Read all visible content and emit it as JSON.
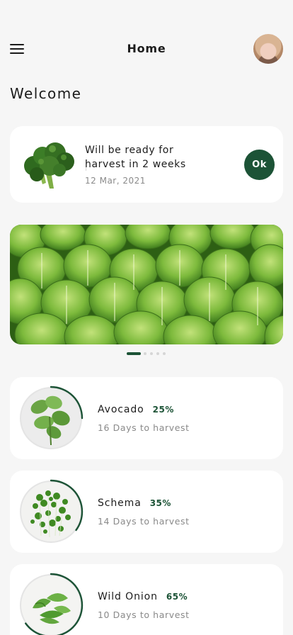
{
  "header": {
    "title": "Home"
  },
  "greeting": "Welcome",
  "notice": {
    "message": "Will be ready for harvest in 2 weeks",
    "date": "12 Mar, 2021",
    "button_label": "Ok"
  },
  "banner": {
    "slide_count": 5,
    "active_slide": 0
  },
  "accent_color": "#1c5336",
  "plants": [
    {
      "name": "Avocado",
      "percent": "25%",
      "progress": 0.25,
      "harvest": "16 Days to harvest"
    },
    {
      "name": "Schema",
      "percent": "35%",
      "progress": 0.35,
      "harvest": "14 Days to harvest"
    },
    {
      "name": "Wild Onion",
      "percent": "65%",
      "progress": 0.65,
      "harvest": "10 Days to harvest"
    }
  ]
}
